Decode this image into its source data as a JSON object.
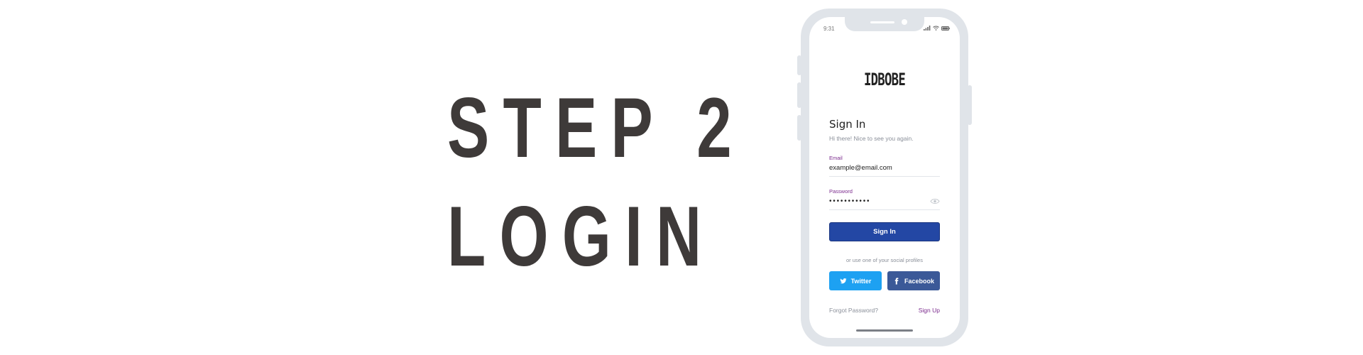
{
  "heading": {
    "line1": "STEP 2",
    "line2": "LOGIN"
  },
  "phone": {
    "status_time": "9:31",
    "logo": "IDBOBE",
    "title": "Sign In",
    "subtitle": "Hi there! Nice to see you again.",
    "email": {
      "label": "Email",
      "value": "example@email.com"
    },
    "password": {
      "label": "Password",
      "value": "•••••••••••",
      "icon": "eye-icon"
    },
    "signin_label": "Sign In",
    "social_note": "or use one of your social profiles",
    "twitter_label": "Twitter",
    "facebook_label": "Facebook",
    "forgot_label": "Forgot Password?",
    "signup_label": "Sign Up"
  },
  "colors": {
    "heading": "#3e3a39",
    "phone_frame": "#e0e4e9",
    "primary": "#2347a4",
    "accent_purple": "#7b2a8d",
    "twitter": "#1da1f2",
    "facebook": "#3b5998"
  }
}
